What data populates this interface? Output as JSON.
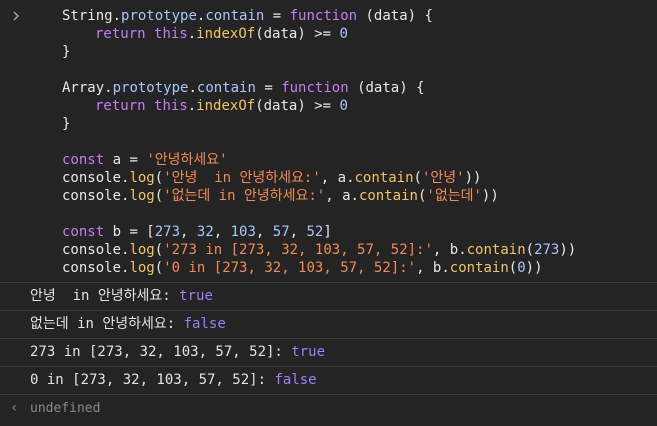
{
  "prompt_icon": "chevron-right-icon",
  "return_icon": "return-arrow-icon",
  "code": {
    "l1": {
      "obj": "String",
      "proto": "prototype",
      "method": "contain",
      "eq": " = ",
      "func": "function",
      "params": " (data) {"
    },
    "l2": {
      "ret": "return",
      "this": "this",
      "call": "indexOf",
      "rest": "(data) >= ",
      "num": "0"
    },
    "l3": "}",
    "l5": {
      "obj": "Array",
      "proto": "prototype",
      "method": "contain",
      "eq": " = ",
      "func": "function",
      "params": " (data) {"
    },
    "l6": {
      "ret": "return",
      "this": "this",
      "call": "indexOf",
      "rest": "(data) >= ",
      "num": "0"
    },
    "l7": "}",
    "l9": {
      "kw": "const",
      "rest": " a = ",
      "str": "'안녕하세요'"
    },
    "l10": {
      "obj": "console",
      "m": "log",
      "str": "'안녕  in 안녕하세요:'",
      "mid": ", a.",
      "call": "contain",
      "arg": "'안녕'",
      "end": "))"
    },
    "l11": {
      "obj": "console",
      "m": "log",
      "str": "'없는데 in 안녕하세요:'",
      "mid": ", a.",
      "call": "contain",
      "arg": "'없는데'",
      "end": "))"
    },
    "l13": {
      "kw": "const",
      "rest": " b = [",
      "n1": "273",
      "n2": "32",
      "n3": "103",
      "n4": "57",
      "n5": "52",
      "end": "]"
    },
    "l14": {
      "obj": "console",
      "m": "log",
      "str": "'273 in [273, 32, 103, 57, 52]:'",
      "mid": ", b.",
      "call": "contain",
      "arg": "273",
      "end": "))"
    },
    "l15": {
      "obj": "console",
      "m": "log",
      "str": "'0 in [273, 32, 103, 57, 52]:'",
      "mid": ", b.",
      "call": "contain",
      "arg": "0",
      "end": "))"
    }
  },
  "output": [
    {
      "text": "안녕  in 안녕하세요: ",
      "value": "true"
    },
    {
      "text": "없는데 in 안녕하세요: ",
      "value": "false"
    },
    {
      "text": "273 in [273, 32, 103, 57, 52]: ",
      "value": "true"
    },
    {
      "text": "0 in [273, 32, 103, 57, 52]: ",
      "value": "false"
    }
  ],
  "result": "undefined",
  "colors": {
    "background": "#242424",
    "keyword": "#c67cf5",
    "function": "#f2c465",
    "string": "#f28b54",
    "boolean": "#9980ff"
  }
}
